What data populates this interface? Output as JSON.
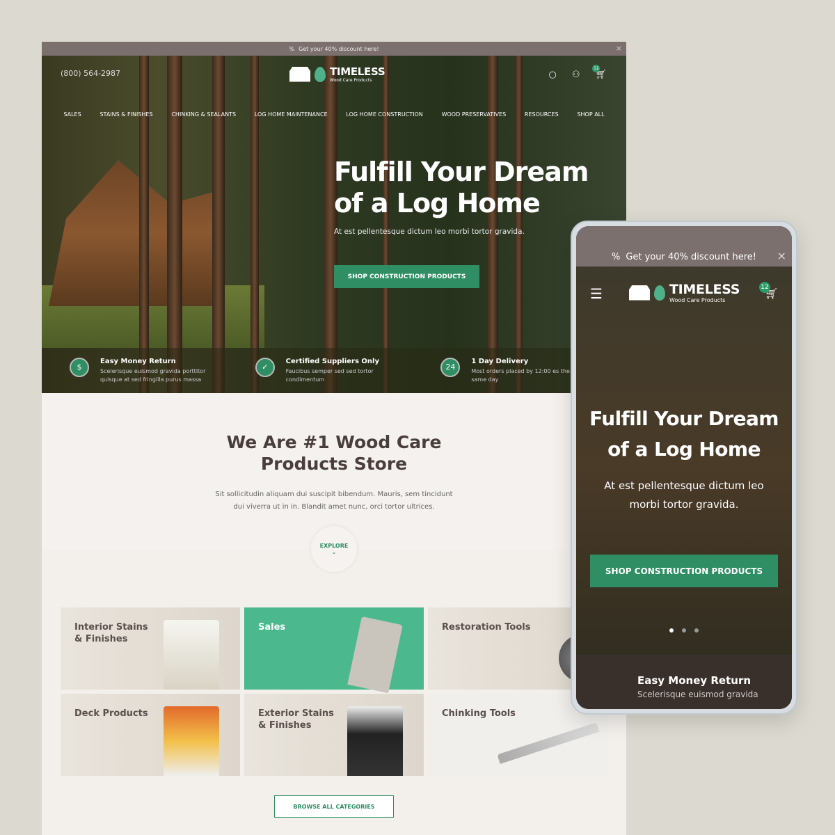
{
  "promo": {
    "text": "Get your 40% discount here!",
    "icon": "percent-icon"
  },
  "header": {
    "phone": "(800) 564-2987",
    "logo_title": "TIMELESS",
    "logo_sub": "Wood Care Products",
    "cart_count": "12"
  },
  "nav": [
    "SALES",
    "STAINS & FINISHES",
    "CHINKING & SEALANTS",
    "LOG HOME MAINTENANCE",
    "LOG HOME CONSTRUCTION",
    "WOOD PRESERVATIVES",
    "RESOURCES",
    "SHOP ALL"
  ],
  "hero": {
    "title_1": "Fulfill Your Dream",
    "title_2": "of a Log Home",
    "subtitle": "At est pellentesque dictum leo morbi tortor gravida.",
    "cta": "SHOP CONSTRUCTION PRODUCTS"
  },
  "features": [
    {
      "title": "Easy Money Return",
      "text": "Scelerisque euismod gravida porttitor quisque at sed fringilla purus massa",
      "icon": "$"
    },
    {
      "title": "Certified Suppliers Only",
      "text": "Faucibus semper sed sed tortor condimentum",
      "icon": "✓"
    },
    {
      "title": "1 Day Delivery",
      "text": "Most orders placed by 12:00 es the same day",
      "icon": "24"
    }
  ],
  "about": {
    "title_1": "We Are #1 Wood Care",
    "title_2": "Products Store",
    "text_1": "Sit sollicitudin aliquam dui suscipit bibendum. Mauris, sem tincidunt",
    "text_2": "dui viverra ut in in. Blandit amet nunc, orci tortor ultrices.",
    "explore": "EXPLORE"
  },
  "categories": [
    "Interior Stains\n& Finishes",
    "Sales",
    "Restoration Tools",
    "Deck Products",
    "Exterior Stains\n& Finishes",
    "Chinking Tools"
  ],
  "browse": "BROWSE ALL CATEGORIES",
  "mobile": {
    "promo": "Get your 40% discount here!",
    "title_1": "Fulfill Your Dream",
    "title_2": "of a Log Home",
    "subtitle": "At est pellentesque dictum leo morbi tortor gravida.",
    "cta": "SHOP CONSTRUCTION PRODUCTS",
    "feature_title": "Easy Money Return",
    "feature_text": "Scelerisque euismod gravida",
    "cart_count": "12"
  },
  "colors": {
    "accent": "#2f8e63",
    "promo_bar": "#7b706e",
    "background": "#dcd9d0"
  }
}
